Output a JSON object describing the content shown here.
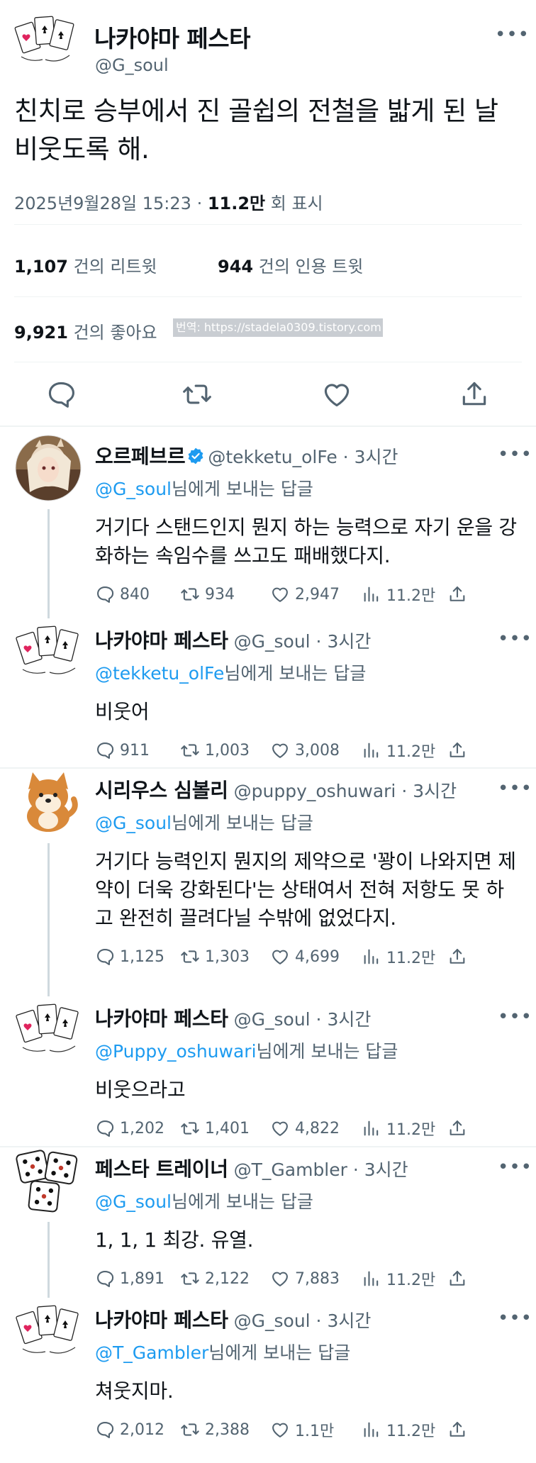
{
  "main_tweet": {
    "author_name": "나카야마 페스타",
    "author_handle": "@G_soul",
    "text": "친치로 승부에서 진 골쉽의 전철을 밟게 된 날 비웃도록 해.",
    "timestamp": "2025년9월28일 15:23",
    "views": "11.2만",
    "views_label": "회 표시",
    "retweets": "1,107",
    "retweets_label": "건의 리트윗",
    "quotes": "944",
    "quotes_label": "건의 인용 트윗",
    "likes": "9,921",
    "likes_label": "건의 좋아요",
    "watermark": "번역: https://stadela0309.tistory.com",
    "more": "•••"
  },
  "reply_to_suffix": "님에게 보내는 답글",
  "replies": [
    {
      "name": "오르페브르",
      "handle": "@tekketu_olFe · 3시간",
      "reply_to": "@G_soul",
      "text": "거기다 스탠드인지 뭔지 하는 능력으로 자기 운을 강화하는 속임수를 쓰고도 패배했다지.",
      "replies": "840",
      "retweets": "934",
      "likes": "2,947",
      "views": "11.2만",
      "more": "•••",
      "avatar": "orfevre-avatar",
      "verified": true
    },
    {
      "name": "나카야마 페스타",
      "handle": "@G_soul · 3시간",
      "reply_to": "@tekketu_olFe",
      "text": "비웃어",
      "replies": "911",
      "retweets": "1,003",
      "likes": "3,008",
      "views": "11.2만",
      "more": "•••",
      "avatar": "playing-cards-avatar"
    },
    {
      "name": "시리우스 심볼리",
      "handle": "@puppy_oshuwari · 3시간",
      "reply_to": "@G_soul",
      "text": "거기다 능력인지 뭔지의 제약으로 '꽝이 나와지면 제약이 더욱 강화된다'는 상태여서 전혀 저항도 못 하고 완전히 끌려다닐 수밖에 없었다지.",
      "replies": "1,125",
      "retweets": "1,303",
      "likes": "4,699",
      "views": "11.2만",
      "more": "•••",
      "avatar": "shiba-dog-avatar"
    },
    {
      "name": "나카야마 페스타",
      "handle": "@G_soul · 3시간",
      "reply_to": "@Puppy_oshuwari",
      "text": "비웃으라고",
      "replies": "1,202",
      "retweets": "1,401",
      "likes": "4,822",
      "views": "11.2만",
      "more": "•••",
      "avatar": "playing-cards-avatar"
    },
    {
      "name": "페스타 트레이너",
      "handle": "@T_Gambler · 3시간",
      "reply_to": "@G_soul",
      "text": "1, 1, 1 최강. 유열.",
      "replies": "1,891",
      "retweets": "2,122",
      "likes": "7,883",
      "views": "11.2만",
      "more": "•••",
      "avatar": "dice-avatar"
    },
    {
      "name": "나카야마 페스타",
      "handle": "@G_soul · 3시간",
      "reply_to": "@T_Gambler",
      "text": "쳐웃지마.",
      "replies": "2,012",
      "retweets": "2,388",
      "likes": "1.1만",
      "views": "11.2만",
      "more": "•••",
      "avatar": "playing-cards-avatar"
    }
  ],
  "colors": {
    "text": "#0f1419",
    "secondary": "#536471",
    "link": "#1d9bf0",
    "divider": "#eff3f4",
    "thread_line": "#cfd9de"
  }
}
